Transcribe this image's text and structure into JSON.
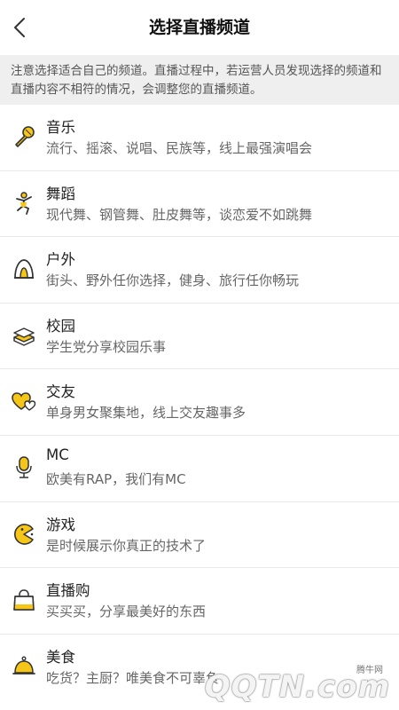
{
  "header": {
    "title": "选择直播频道"
  },
  "notice": {
    "text": "注意选择适合自己的频道。直播过程中，若运营人员发现选择的频道和直播内容不相符的情况，会调整您的直播频道。"
  },
  "colors": {
    "accent": "#F5C518",
    "icon_stroke": "#333333",
    "notice_bg": "#EFEFEF"
  },
  "channels": [
    {
      "name": "音乐",
      "desc": "流行、摇滚、说唱、民族等，线上最强演唱会",
      "icon": "microphone-icon"
    },
    {
      "name": "舞蹈",
      "desc": "现代舞、钢管舞、肚皮舞等，谈恋爱不如跳舞",
      "icon": "dancer-icon"
    },
    {
      "name": "户外",
      "desc": "街头、野外任你选择，健身、旅行任你畅玩",
      "icon": "tent-icon"
    },
    {
      "name": "校园",
      "desc": "学生党分享校园乐事",
      "icon": "books-icon"
    },
    {
      "name": "交友",
      "desc": "单身男女聚集地，线上交友趣事多",
      "icon": "hearts-icon"
    },
    {
      "name": "MC",
      "desc": "欧美有RAP，我们有MC",
      "icon": "mic-stand-icon"
    },
    {
      "name": "游戏",
      "desc": "是时候展示你真正的技术了",
      "icon": "pacman-icon"
    },
    {
      "name": "直播购",
      "desc": "买买买，分享最美好的东西",
      "icon": "shopping-bag-icon"
    },
    {
      "name": "美食",
      "desc": "吃货？主厨？唯美食不可辜负",
      "icon": "food-cloche-icon"
    }
  ],
  "watermark": {
    "text": "腾牛网",
    "logo": "QQTN.com"
  }
}
